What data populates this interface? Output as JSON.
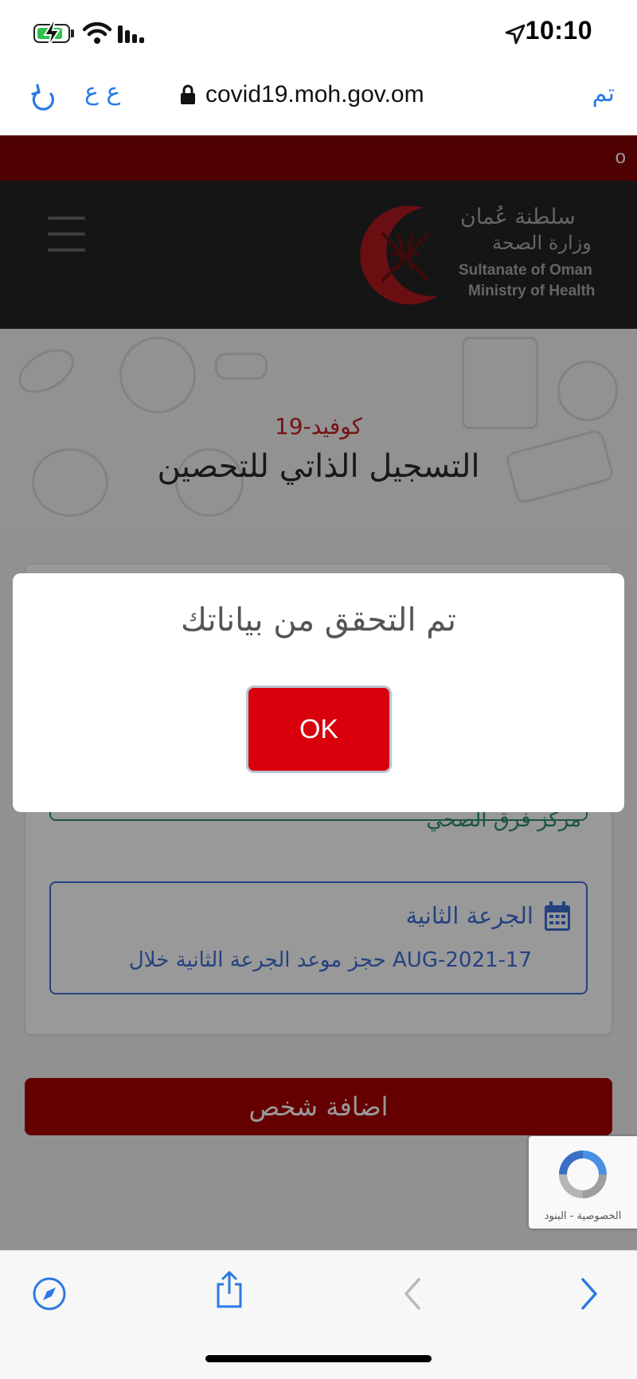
{
  "status_bar": {
    "time": "10:10",
    "icons": [
      "battery-charging-icon",
      "wifi-icon",
      "cellular-signal-icon",
      "location-arrow-icon"
    ]
  },
  "browser": {
    "reader_label": "ع ع",
    "url": "covid19.moh.gov.om",
    "done_label": "تم",
    "icons": [
      "reload-icon",
      "lock-icon"
    ]
  },
  "ticker": {
    "visible_text": "o"
  },
  "site_header": {
    "logo_ar_line1": "سلطنة عُمان",
    "logo_ar_line2": "وزارة الصحة",
    "logo_en_line1": "Sultanate of Oman",
    "logo_en_line2": "Ministry of Health",
    "menu_icon": "hamburger-menu-icon"
  },
  "hero": {
    "subtitle": "كوفيد-19",
    "title": "التسجيل الذاتي للتحصين"
  },
  "center": {
    "name": "مركز فرق الصحي"
  },
  "second_dose": {
    "title": "الجرعة الثانية",
    "text": "حجز موعد الجرعة الثانية خلال AUG-2021-17",
    "icon": "calendar-icon"
  },
  "add_person_label": "اضافة شخص",
  "recaptcha": {
    "label": "الخصوصية - البنود",
    "icon": "recaptcha-icon"
  },
  "modal": {
    "message": "تم التحقق من بياناتك",
    "ok_label": "OK"
  },
  "colors": {
    "brand_red": "#a80000",
    "ticker_red": "#840000",
    "header_dark": "#232323",
    "link_blue": "#2a7ae4",
    "green": "#2e8b72",
    "dose_blue": "#3e6fd6",
    "ok_red": "#d7000b"
  },
  "toolbar": {
    "icons": [
      "compass-icon",
      "share-icon",
      "back-chevron-icon",
      "forward-chevron-icon"
    ]
  }
}
